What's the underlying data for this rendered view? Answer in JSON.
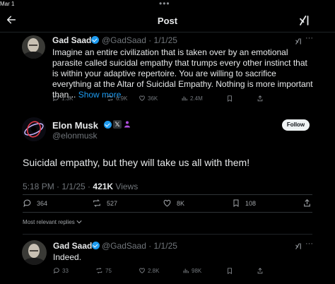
{
  "status_bar": {
    "date": "Mar 1"
  },
  "header": {
    "title": "Post"
  },
  "quoted_post": {
    "name": "Gad Saad",
    "handle_date": "@GadSaad · 1/1/25",
    "text": "Imagine an entire civilization that is taken over by an emotional parasite called suicidal empathy that trumps every other instinct that is within your adaptive repertoire.  You are willing to sacrifice everything at the Altar of Suicidal Empathy.  Nothing is more important than...",
    "show_more": "Show more",
    "metrics": {
      "replies": "1.3K",
      "reposts": "6.9K",
      "likes": "36K",
      "views": "2.4M"
    }
  },
  "main_post": {
    "name": "Elon Musk",
    "handle": "@elonmusk",
    "follow_label": "Follow",
    "text": "Suicidal empathy, but they will take us all with them!",
    "time": "5:18 PM · 1/1/25 · ",
    "views_count": "421K",
    "views_label": " Views",
    "actions": {
      "replies": "364",
      "reposts": "527",
      "likes": "8K",
      "bookmarks": "108"
    }
  },
  "replies_filter": {
    "label": "Most relevant replies"
  },
  "reply": {
    "name": "Gad Saad",
    "handle_date": "@GadSaad · 1/1/25",
    "text": "Indeed.",
    "metrics": {
      "replies": "33",
      "reposts": "75",
      "likes": "2.8K",
      "views": "98K"
    }
  },
  "colors": {
    "accent": "#1d9bf0",
    "background": "#000000",
    "muted": "#71767b"
  }
}
